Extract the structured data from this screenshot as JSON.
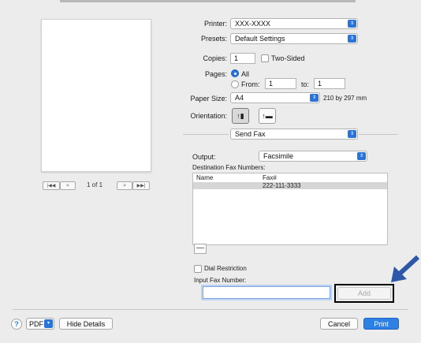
{
  "preview": {
    "page_indicator": "1 of 1",
    "first_label": "|◀◀",
    "prev_label": "<",
    "next_label": ">",
    "last_label": "▶▶|"
  },
  "printer": {
    "label": "Printer:",
    "value": "XXX-XXXX"
  },
  "presets": {
    "label": "Presets:",
    "value": "Default Settings"
  },
  "copies": {
    "label": "Copies:",
    "value": "1",
    "two_sided_label": "Two-Sided"
  },
  "pages": {
    "label": "Pages:",
    "all_label": "All",
    "from_label": "From:",
    "from_value": "1",
    "to_label": "to:",
    "to_value": "1"
  },
  "paper_size": {
    "label": "Paper Size:",
    "value": "A4",
    "dimensions": "210 by 297 mm"
  },
  "orientation": {
    "label": "Orientation:"
  },
  "section": {
    "value": "Send Fax"
  },
  "output": {
    "label": "Output:",
    "value": "Facsimile"
  },
  "destination": {
    "label": "Destination Fax Numbers:",
    "columns": [
      "Name",
      "Fax#"
    ],
    "rows": [
      {
        "name": "",
        "fax": "222-111-3333"
      }
    ],
    "remove_label": "—"
  },
  "dial_restriction": {
    "label": "Dial Restriction"
  },
  "input_fax": {
    "label": "Input Fax Number:",
    "value": "",
    "add_label": "Add"
  },
  "footer": {
    "help_label": "?",
    "pdf_label": "PDF",
    "hide_details_label": "Hide Details",
    "cancel_label": "Cancel",
    "print_label": "Print"
  },
  "colors": {
    "accent": "#2f80e4",
    "annotation_arrow": "#2d57a8"
  }
}
